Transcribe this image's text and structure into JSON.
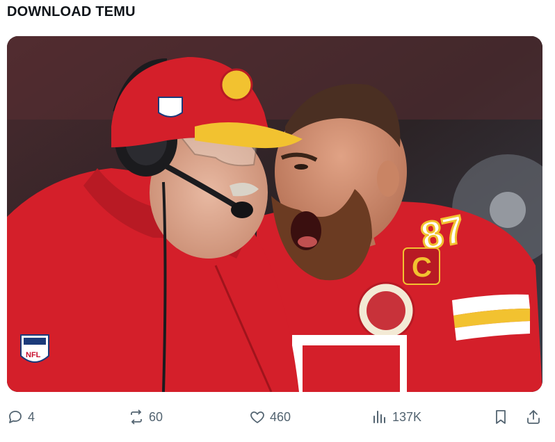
{
  "post": {
    "text": "DOWNLOAD TEMU"
  },
  "media": {
    "jersey_number": "87",
    "captain_patch": "C",
    "logo_text": "NFL",
    "colors": {
      "red": "#d41f2a",
      "gold": "#f2c230",
      "skin": "#d9a48a",
      "beard": "#6b3b22"
    }
  },
  "actions": {
    "reply": {
      "icon": "reply-icon",
      "count": "4"
    },
    "repost": {
      "icon": "repost-icon",
      "count": "60"
    },
    "like": {
      "icon": "heart-icon",
      "count": "460"
    },
    "views": {
      "icon": "views-icon",
      "count": "137K"
    },
    "bookmark": {
      "icon": "bookmark-icon"
    },
    "share": {
      "icon": "share-icon"
    }
  }
}
